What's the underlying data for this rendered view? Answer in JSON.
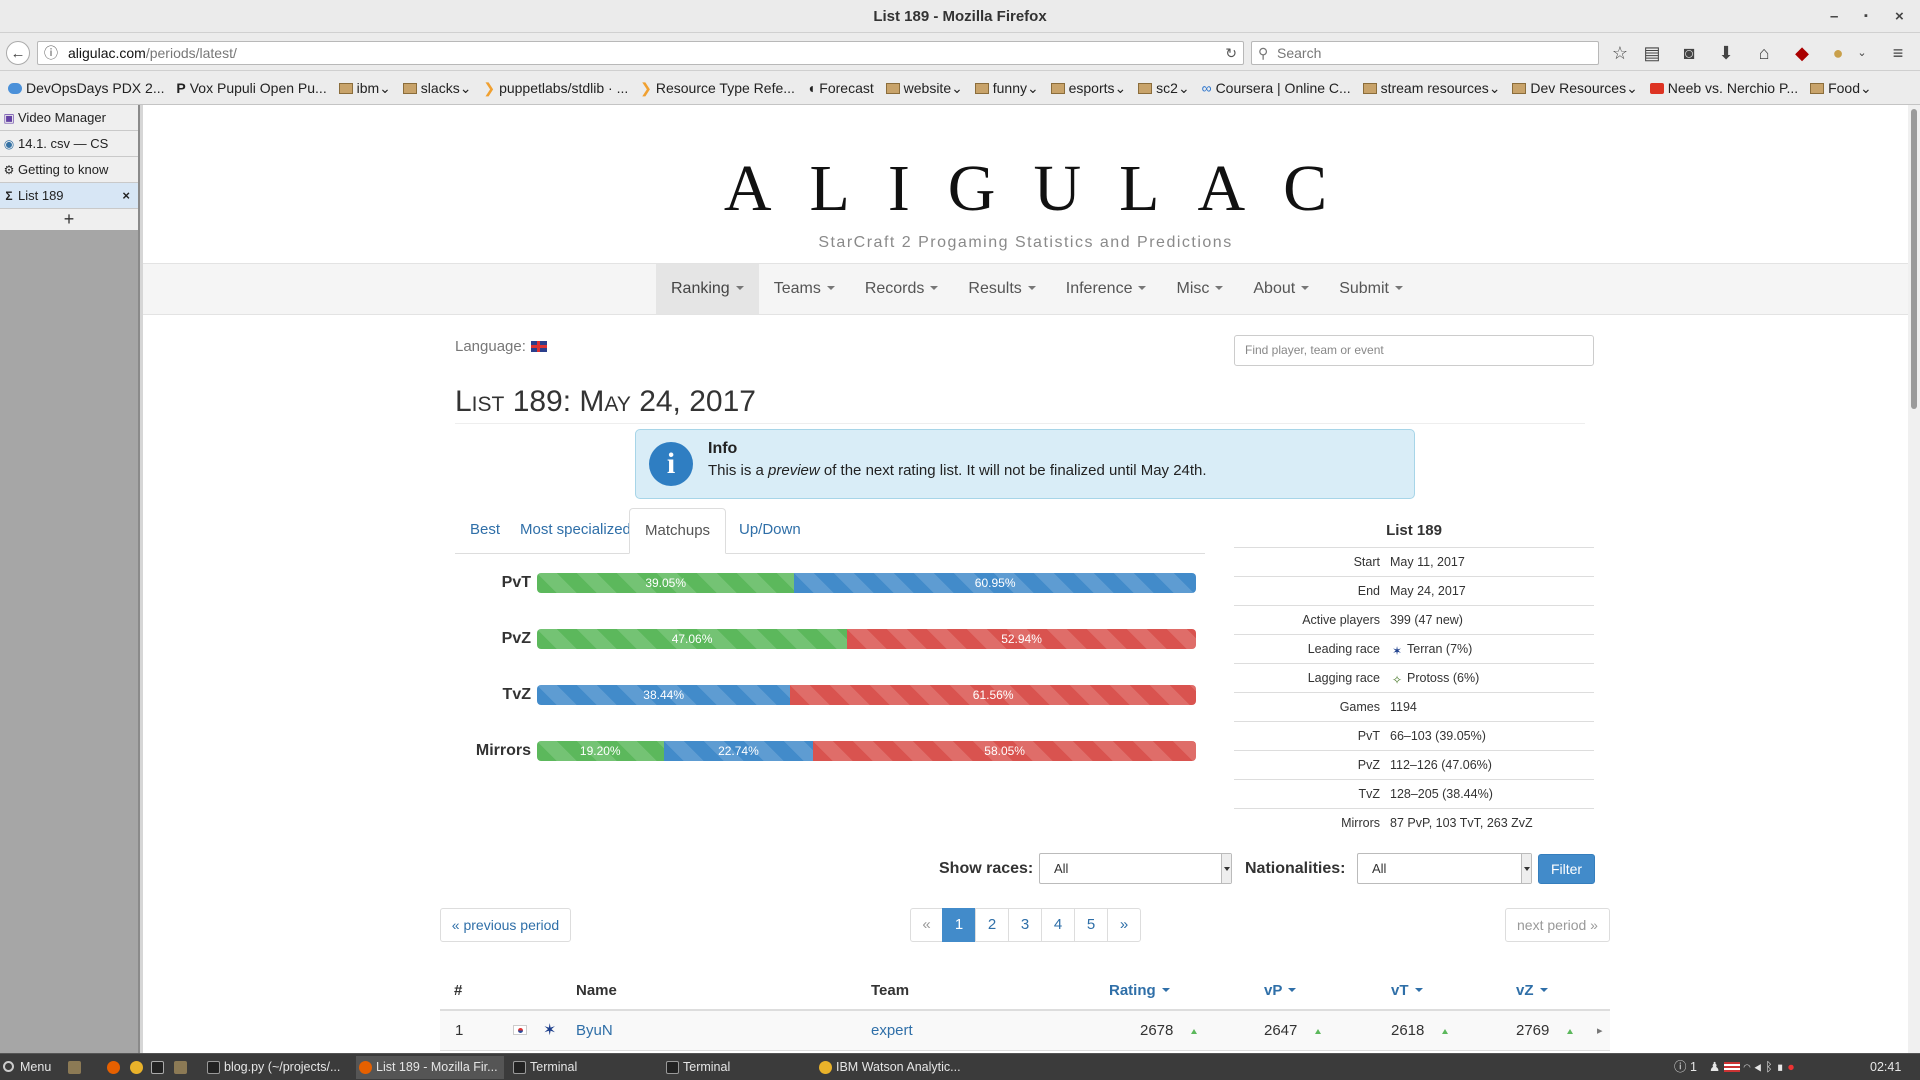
{
  "window": {
    "title": "List 189 - Mozilla Firefox",
    "controls": [
      "–",
      "▪",
      "×"
    ]
  },
  "browser": {
    "url_host": "aligulac.com",
    "url_path": "/periods/latest/",
    "search_placeholder": "Search"
  },
  "bookmarks": [
    {
      "label": "DevOpsDays PDX 2...",
      "icon": "globe-icon"
    },
    {
      "label": "Vox Pupuli Open Pu...",
      "icon": "p-icon"
    },
    {
      "label": "ibm",
      "icon": "folder-icon"
    },
    {
      "label": "slacks",
      "icon": "folder-icon"
    },
    {
      "label": "puppetlabs/stdlib · ...",
      "icon": "puppet-icon"
    },
    {
      "label": "Resource Type Refe...",
      "icon": "puppet-icon"
    },
    {
      "label": "Forecast",
      "icon": "weather-icon"
    },
    {
      "label": "website",
      "icon": "folder-icon"
    },
    {
      "label": "funny",
      "icon": "folder-icon"
    },
    {
      "label": "esports",
      "icon": "folder-icon"
    },
    {
      "label": "sc2",
      "icon": "folder-icon"
    },
    {
      "label": "Coursera | Online C...",
      "icon": "coursera-icon"
    },
    {
      "label": "stream resources",
      "icon": "folder-icon"
    },
    {
      "label": "Dev Resources",
      "icon": "folder-icon"
    },
    {
      "label": "Neeb vs. Nerchio P...",
      "icon": "youtube-icon"
    },
    {
      "label": "Food",
      "icon": "folder-icon"
    }
  ],
  "tabs": [
    {
      "label": "Video Manager",
      "icon": "twitch-icon"
    },
    {
      "label": "14.1. csv — CS",
      "icon": "python-icon"
    },
    {
      "label": "Getting to know",
      "icon": "bike-icon"
    },
    {
      "label": "List 189",
      "icon": "sigma-icon",
      "close": "×"
    }
  ],
  "new_tab": "+",
  "site": {
    "logo": "ALIGULAC",
    "tagline": "StarCraft 2 Progaming Statistics and Predictions",
    "nav": [
      "Ranking",
      "Teams",
      "Records",
      "Results",
      "Inference",
      "Misc",
      "About",
      "Submit"
    ],
    "language_label": "Language:",
    "find_placeholder": "Find player, team or event"
  },
  "page": {
    "title": "List 189: May 24, 2017",
    "info_title": "Info",
    "info_text_pre": "This is a ",
    "info_text_em": "preview",
    "info_text_post": " of the next rating list. It will not be finalized until May 24th.",
    "tabs": [
      "Best",
      "Most specialized",
      "Matchups",
      "Up/Down"
    ]
  },
  "matchups": [
    {
      "label": "PvT",
      "segments": [
        {
          "value": 39.05,
          "text": "39.05%",
          "color": "green"
        },
        {
          "value": 60.95,
          "text": "60.95%",
          "color": "blue"
        }
      ]
    },
    {
      "label": "PvZ",
      "segments": [
        {
          "value": 47.06,
          "text": "47.06%",
          "color": "green"
        },
        {
          "value": 52.94,
          "text": "52.94%",
          "color": "red"
        }
      ]
    },
    {
      "label": "TvZ",
      "segments": [
        {
          "value": 38.44,
          "text": "38.44%",
          "color": "blue"
        },
        {
          "value": 61.56,
          "text": "61.56%",
          "color": "red"
        }
      ]
    },
    {
      "label": "Mirrors",
      "segments": [
        {
          "value": 19.2,
          "text": "19.20%",
          "color": "green"
        },
        {
          "value": 22.74,
          "text": "22.74%",
          "color": "blue"
        },
        {
          "value": 58.05,
          "text": "58.05%",
          "color": "red"
        }
      ]
    }
  ],
  "colors": {
    "protoss": "#5cb85c",
    "terran": "#428bca",
    "zerg": "#d9534f",
    "link": "#2f6fa8"
  },
  "stats": {
    "title": "List 189",
    "rows": [
      {
        "key": "Start",
        "value": "May 11, 2017"
      },
      {
        "key": "End",
        "value": "May 24, 2017"
      },
      {
        "key": "Active players",
        "value": "399 (47 new)"
      },
      {
        "key": "Leading race",
        "value": "Terran (7%)",
        "icon": "terran-icon"
      },
      {
        "key": "Lagging race",
        "value": "Protoss (6%)",
        "icon": "protoss-icon"
      },
      {
        "key": "Games",
        "value": "1194"
      },
      {
        "key": "PvT",
        "value": "66–103 (39.05%)"
      },
      {
        "key": "PvZ",
        "value": "112–126 (47.06%)"
      },
      {
        "key": "TvZ",
        "value": "128–205 (38.44%)"
      },
      {
        "key": "Mirrors",
        "value": "87 PvP, 103 TvT, 263 ZvZ"
      }
    ]
  },
  "filters": {
    "races_label": "Show races:",
    "races_value": "All",
    "nat_label": "Nationalities:",
    "nat_value": "All",
    "filter_button": "Filter"
  },
  "pager": {
    "prev": "« previous period",
    "next": "next period »",
    "first": "«",
    "last": "»",
    "pages": [
      "1",
      "2",
      "3",
      "4",
      "5"
    ]
  },
  "ranking": {
    "headers": {
      "num": "#",
      "name": "Name",
      "team": "Team",
      "rating": "Rating",
      "vp": "vP",
      "vt": "vT",
      "vz": "vZ"
    },
    "rows": [
      {
        "rank": "1",
        "name": "ByuN",
        "team": "expert",
        "rating": "2678",
        "vp": "2647",
        "vt": "2618",
        "vz": "2769"
      }
    ]
  },
  "taskbar": {
    "menu": "Menu",
    "windows": [
      "blog.py (~/projects/...",
      "List 189 - Mozilla Fir...",
      "Terminal",
      "Terminal",
      "IBM Watson Analytic..."
    ],
    "tray_count": "1",
    "clock": "02:41"
  }
}
